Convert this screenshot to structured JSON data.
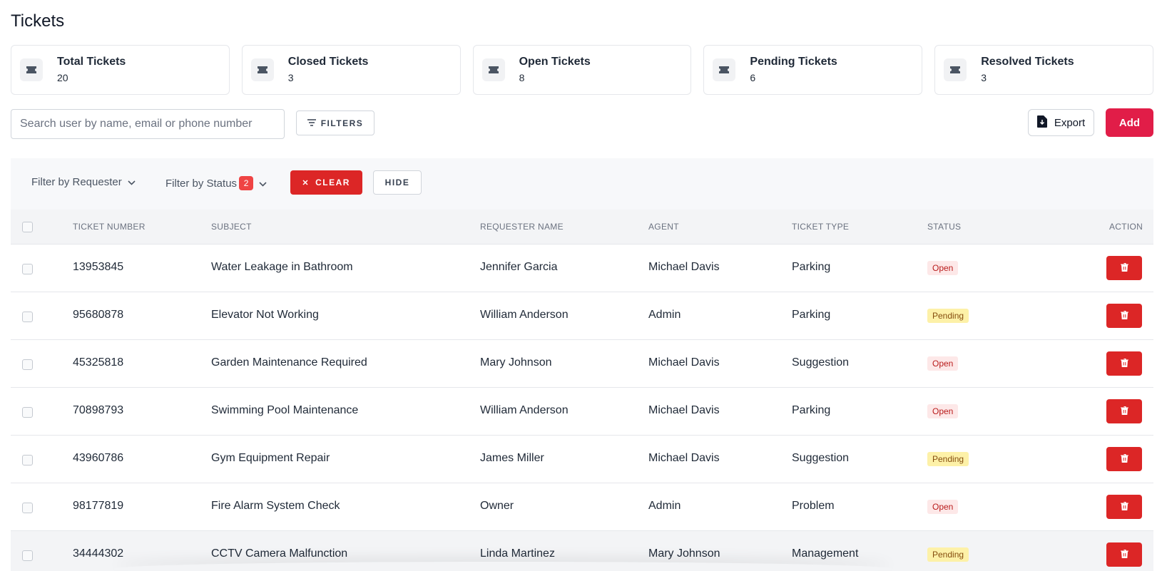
{
  "page": {
    "title": "Tickets"
  },
  "stats": [
    {
      "label": "Total Tickets",
      "value": "20",
      "icon": "ticket-icon"
    },
    {
      "label": "Closed Tickets",
      "value": "3",
      "icon": "ticket-icon"
    },
    {
      "label": "Open Tickets",
      "value": "8",
      "icon": "ticket-icon"
    },
    {
      "label": "Pending Tickets",
      "value": "6",
      "icon": "ticket-icon"
    },
    {
      "label": "Resolved Tickets",
      "value": "3",
      "icon": "ticket-icon"
    }
  ],
  "toolbar": {
    "search_placeholder": "Search user by name, email or phone number",
    "search_value": "",
    "filters_label": "FILTERS",
    "export_label": "Export",
    "add_label": "Add"
  },
  "filter_bar": {
    "requester_label": "Filter by Requester",
    "status_label": "Filter by Status",
    "status_count": "2",
    "clear_label": "CLEAR",
    "hide_label": "HIDE"
  },
  "table": {
    "columns": {
      "ticket_number": "TICKET NUMBER",
      "subject": "SUBJECT",
      "requester": "REQUESTER NAME",
      "agent": "AGENT",
      "type": "TICKET TYPE",
      "status": "STATUS",
      "action": "ACTION"
    },
    "rows": [
      {
        "ticket_number": "13953845",
        "subject": "Water Leakage in Bathroom",
        "requester": "Jennifer Garcia",
        "agent": "Michael Davis",
        "type": "Parking",
        "status": "Open"
      },
      {
        "ticket_number": "95680878",
        "subject": "Elevator Not Working",
        "requester": "William Anderson",
        "agent": "Admin",
        "type": "Parking",
        "status": "Pending"
      },
      {
        "ticket_number": "45325818",
        "subject": "Garden Maintenance Required",
        "requester": "Mary Johnson",
        "agent": "Michael Davis",
        "type": "Suggestion",
        "status": "Open"
      },
      {
        "ticket_number": "70898793",
        "subject": "Swimming Pool Maintenance",
        "requester": "William Anderson",
        "agent": "Michael Davis",
        "type": "Parking",
        "status": "Open"
      },
      {
        "ticket_number": "43960786",
        "subject": "Gym Equipment Repair",
        "requester": "James Miller",
        "agent": "Michael Davis",
        "type": "Suggestion",
        "status": "Pending"
      },
      {
        "ticket_number": "98177819",
        "subject": "Fire Alarm System Check",
        "requester": "Owner",
        "agent": "Admin",
        "type": "Problem",
        "status": "Open"
      },
      {
        "ticket_number": "34444302",
        "subject": "CCTV Camera Malfunction",
        "requester": "Linda Martinez",
        "agent": "Mary Johnson",
        "type": "Management",
        "status": "Pending"
      }
    ]
  },
  "colors": {
    "primary": "#e11d48",
    "danger": "#dc2626",
    "open_bg": "#fde8e8",
    "open_text": "#b91c1c",
    "pending_bg": "#fdf1a8",
    "pending_text": "#854d0e"
  }
}
